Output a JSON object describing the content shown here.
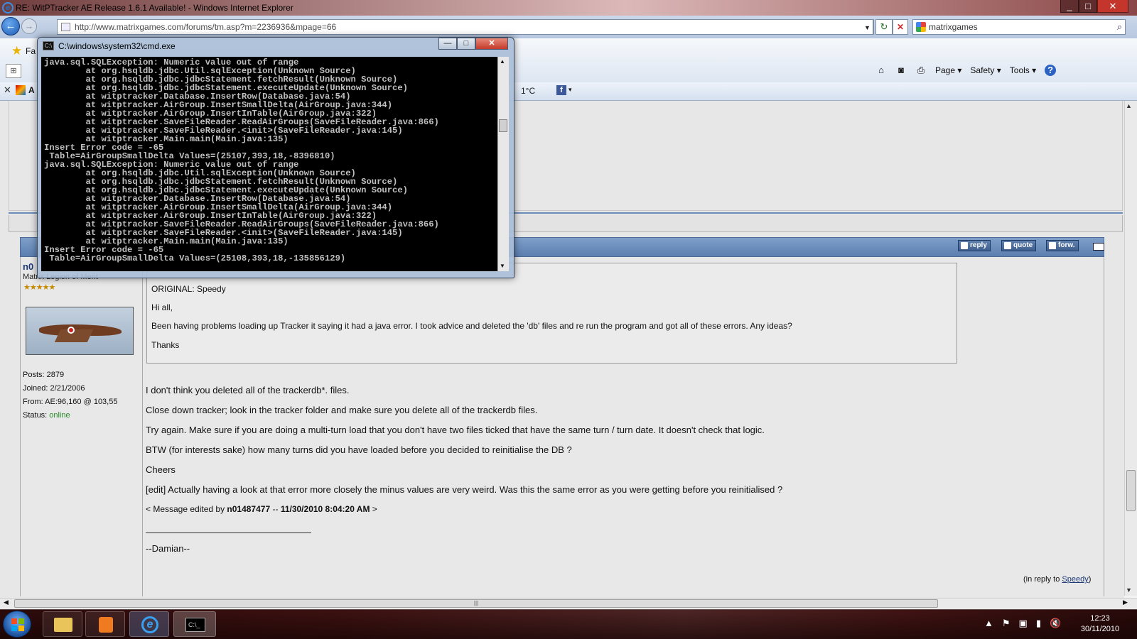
{
  "window": {
    "title": "RE: WitPTracker AE Release 1.6.1 Available! - Windows Internet Explorer",
    "min": "_",
    "max": "□",
    "close": "✕"
  },
  "navbar": {
    "back": "←",
    "forward": "→",
    "address": "http://www.matrixgames.com/forums/tm.asp?m=2236936&mpage=66",
    "dropdown": "▼",
    "refresh": "↻",
    "stop": "✕",
    "search_value": "matrixgames",
    "search_icon": "⌕"
  },
  "commandbar": {
    "favorites_icon": "★",
    "favorites": "Fa",
    "tab_grid": "⊞",
    "home": "⌂",
    "feeds": "◙",
    "print": "⎙",
    "page": "Page ▾",
    "safety": "Safety ▾",
    "tools": "Tools ▾",
    "help": "?"
  },
  "linkbar": {
    "close": "✕",
    "site_initial": "A",
    "temperature": "1°C",
    "facebook": "f",
    "dropdown": "▾"
  },
  "cmd": {
    "title": "C:\\windows\\system32\\cmd.exe",
    "icon": "C:\\",
    "min": "—",
    "max": "□",
    "close": "✕",
    "up": "▲",
    "down": "▼",
    "lines": [
      "java.sql.SQLException: Numeric value out of range",
      "        at org.hsqldb.jdbc.Util.sqlException(Unknown Source)",
      "        at org.hsqldb.jdbc.jdbcStatement.fetchResult(Unknown Source)",
      "        at org.hsqldb.jdbc.jdbcStatement.executeUpdate(Unknown Source)",
      "        at witptracker.Database.InsertRow(Database.java:54)",
      "        at witptracker.AirGroup.InsertSmallDelta(AirGroup.java:344)",
      "        at witptracker.AirGroup.InsertInTable(AirGroup.java:322)",
      "        at witptracker.SaveFileReader.ReadAirGroups(SaveFileReader.java:866)",
      "        at witptracker.SaveFileReader.<init>(SaveFileReader.java:145)",
      "        at witptracker.Main.main(Main.java:135)",
      "Insert Error code = -65",
      " Table=AirGroupSmallDelta Values=(25107,393,18,-8396810)",
      "java.sql.SQLException: Numeric value out of range",
      "        at org.hsqldb.jdbc.Util.sqlException(Unknown Source)",
      "        at org.hsqldb.jdbc.jdbcStatement.fetchResult(Unknown Source)",
      "        at org.hsqldb.jdbc.jdbcStatement.executeUpdate(Unknown Source)",
      "        at witptracker.Database.InsertRow(Database.java:54)",
      "        at witptracker.AirGroup.InsertSmallDelta(AirGroup.java:344)",
      "        at witptracker.AirGroup.InsertInTable(AirGroup.java:322)",
      "        at witptracker.SaveFileReader.ReadAirGroups(SaveFileReader.java:866)",
      "        at witptracker.SaveFileReader.<init>(SaveFileReader.java:145)",
      "        at witptracker.Main.main(Main.java:135)",
      "Insert Error code = -65",
      " Table=AirGroupSmallDelta Values=(25108,393,18,-135856129)"
    ]
  },
  "post": {
    "buttons": {
      "reply": "reply",
      "quote": "quote",
      "forward": "forw."
    },
    "author": {
      "name": "n0",
      "rank": "Matrix Legion of Merit",
      "stars": "★★★★★",
      "posts": "Posts: 2879",
      "joined": "Joined: 2/21/2006",
      "from": "From: AE:96,160 @ 103,55",
      "status_label": "Status: ",
      "status_value": "online"
    },
    "quote": {
      "original": "ORIGINAL: Speedy",
      "greeting": "Hi all,",
      "body": "Been having problems loading up Tracker it saying it had a java error. I took advice and deleted the 'db' files and re run the program and got all of these errors. Any ideas?",
      "thanks": "Thanks"
    },
    "paragraphs": [
      "I don't think you deleted all of the trackerdb*. files.",
      "Close down tracker; look in the tracker folder and make sure you delete all of the trackerdb files.",
      "Try again. Make sure if you are doing a multi-turn load that you don't have two files ticked that have the same turn / turn date. It doesn't check that logic.",
      "BTW (for interests sake) how many turns did you have loaded before you decided to reinitialise the DB ?",
      "Cheers",
      "[edit] Actually having a look at that error more closely the minus values are very weird. Was this the same error as you were getting before you reinitialised ?"
    ],
    "edited_prefix": "< Message edited by ",
    "edited_user": "n01487477",
    "edited_sep": " -- ",
    "edited_date": "11/30/2010 8:04:20 AM",
    "edited_suffix": " >",
    "signature": "--Damian--",
    "in_reply_prefix": "(in reply to ",
    "in_reply_user": "Speedy",
    "in_reply_suffix": ")"
  },
  "scroll": {
    "up": "▲",
    "down": "▼",
    "left": "◀",
    "right": "▶",
    "grip": "|||"
  },
  "taskbar": {
    "cmd_icon": "C:\\_",
    "tray": [
      "▲",
      "⚑",
      "▣",
      "▮",
      "🔇"
    ],
    "time": "12:23",
    "date": "30/11/2010"
  }
}
